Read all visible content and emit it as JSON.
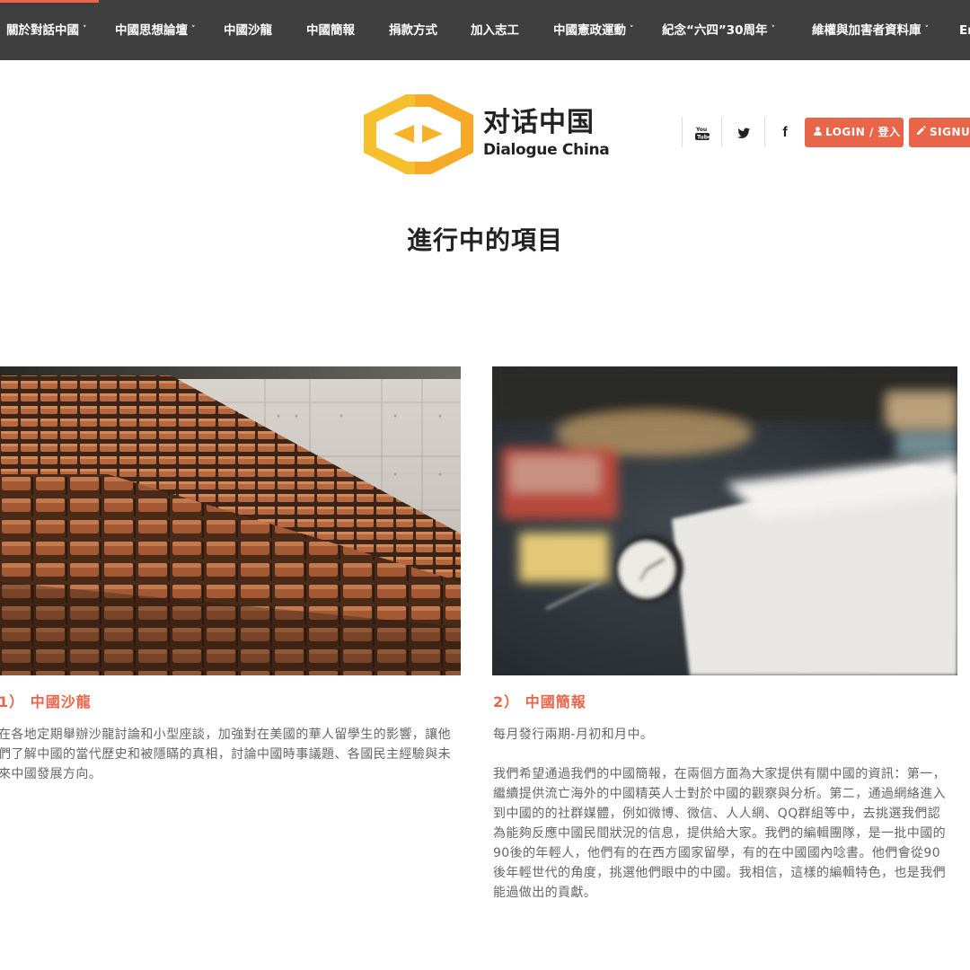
{
  "nav": {
    "items": [
      {
        "label": "關於對話中國",
        "has_dropdown": true
      },
      {
        "label": "中國思想論壇",
        "has_dropdown": true
      },
      {
        "label": "中國沙龍",
        "has_dropdown": false
      },
      {
        "label": "中國簡報",
        "has_dropdown": false
      },
      {
        "label": "捐款方式",
        "has_dropdown": false
      },
      {
        "label": "加入志工",
        "has_dropdown": false
      },
      {
        "label": "中國憲政運動",
        "has_dropdown": true
      },
      {
        "label": "紀念“六四”30周年",
        "has_dropdown": true
      },
      {
        "label": "維權與加害者資料庫",
        "has_dropdown": true
      },
      {
        "label": "En",
        "has_dropdown": false
      }
    ],
    "caret": "˅",
    "background": "#3f3f3f",
    "accent": "#e8654a"
  },
  "header": {
    "logo_cn": "对话中国",
    "logo_en": "Dialogue China",
    "logo_color": "#f5b82e",
    "social_icons": [
      "youtube-icon",
      "twitter-icon",
      "facebook-icon"
    ],
    "social_glyphs": {
      "youtube": "You",
      "twitter": "🐦",
      "facebook": "f"
    },
    "login_label": "LOGIN / 登入",
    "signup_label": "SIGNUP",
    "button_color": "#e8654a"
  },
  "main": {
    "section_title": "進行中的項目",
    "cards": [
      {
        "title": "1） 中國沙龍",
        "paragraphs": [
          "在各地定期舉辦沙龍討論和小型座談，加強對在美國的華人留學生的影響，讓他們了解中國的當代歷史和被隱瞞的真相，討論中國時事議題、各國民主經驗與未來中國發展方向。"
        ],
        "image": "auditorium-seats-photo"
      },
      {
        "title": "2） 中國簡報",
        "paragraphs": [
          "每月發行兩期-月初和月中。",
          "我們希望通過我們的中國簡報，在兩個方面為大家提供有關中國的資訊：第一，繼續提供流亡海外的中國精英人士對於中國的觀察與分析。第二，通過網絡進入到中國的的社群媒體，例如微博、微信、人人網、QQ群組等中，去挑選我們認為能夠反應中國民間狀況的信息，提供給大家。我們的編輯團隊，是一批中國的90後的年輕人，他們有的在西方國家留學，有的在中國國內唸書。他們會從90後年輕世代的角度，挑選他們眼中的中國。我相信，這樣的編輯特色，也是我們能過做出的貢獻。"
        ],
        "image": "desk-clock-photo"
      }
    ]
  }
}
